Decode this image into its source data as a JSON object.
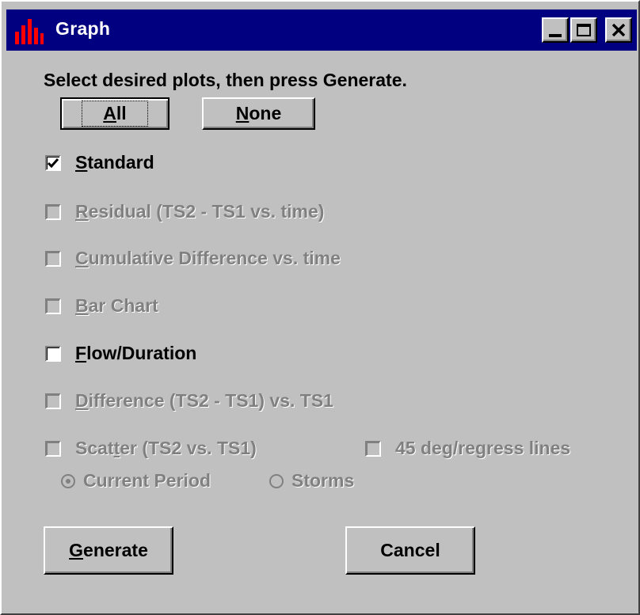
{
  "window": {
    "title": "Graph",
    "icon": "bar-chart-icon",
    "controls": [
      "minimize-icon",
      "maximize-icon",
      "close-icon"
    ]
  },
  "instruction": "Select desired plots, then press Generate.",
  "buttons": {
    "all": {
      "pre": "",
      "key": "A",
      "post": "ll"
    },
    "none": {
      "pre": "",
      "key": "N",
      "post": "one"
    },
    "generate": {
      "pre": "",
      "key": "G",
      "post": "enerate"
    },
    "cancel": "Cancel"
  },
  "plots": {
    "standard": {
      "key": "S",
      "post": "tandard",
      "checked": true,
      "enabled": true
    },
    "residual": {
      "key": "R",
      "post": "esidual (TS2 - TS1 vs. time)",
      "checked": false,
      "enabled": false
    },
    "cumulative": {
      "key": "C",
      "post": "umulative Difference vs. time",
      "checked": false,
      "enabled": false
    },
    "bar": {
      "key": "B",
      "post": "ar Chart",
      "checked": false,
      "enabled": false
    },
    "flow": {
      "key": "F",
      "post": "low/Duration",
      "checked": false,
      "enabled": true
    },
    "difference": {
      "key": "D",
      "post": "ifference (TS2 - TS1) vs. TS1",
      "checked": false,
      "enabled": false
    },
    "scatter": {
      "pre": "Scat",
      "key": "t",
      "post": "er (TS2  vs. TS1)",
      "checked": false,
      "enabled": false
    },
    "regress": {
      "label": "45 deg/regress lines",
      "checked": false,
      "enabled": false
    }
  },
  "period": {
    "current": {
      "label": "Current Period",
      "selected": true
    },
    "storms": {
      "label": "Storms",
      "selected": false
    }
  },
  "colors": {
    "titlebar": "#000080",
    "face": "#c0c0c0",
    "disabled_text": "#808080",
    "icon_red": "#ff0000"
  }
}
